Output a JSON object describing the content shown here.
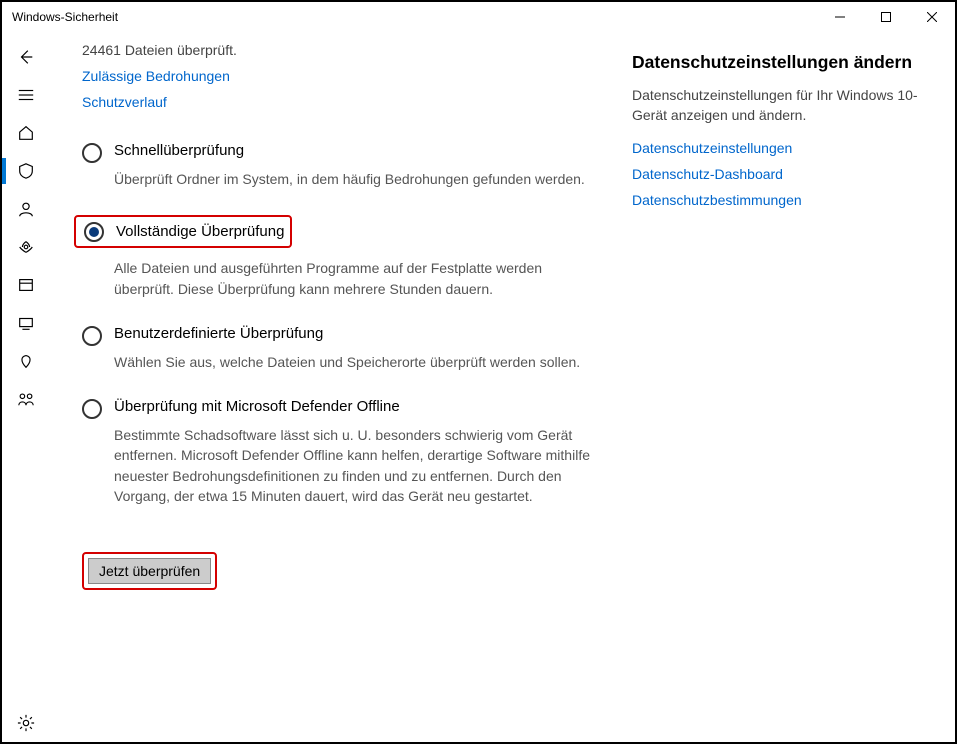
{
  "window": {
    "title": "Windows-Sicherheit"
  },
  "status": "24461 Dateien überprüft.",
  "links": {
    "allowed_threats": "Zulässige Bedrohungen",
    "protection_history": "Schutzverlauf"
  },
  "scan_options": [
    {
      "id": "quick",
      "title": "Schnellüberprüfung",
      "desc": "Überprüft Ordner im System, in dem häufig Bedrohungen gefunden werden.",
      "selected": false
    },
    {
      "id": "full",
      "title": "Vollständige Überprüfung",
      "desc": "Alle Dateien und ausgeführten Programme auf der Festplatte werden überprüft. Diese Überprüfung kann mehrere Stunden dauern.",
      "selected": true
    },
    {
      "id": "custom",
      "title": "Benutzerdefinierte Überprüfung",
      "desc": "Wählen Sie aus, welche Dateien und Speicherorte überprüft werden sollen.",
      "selected": false
    },
    {
      "id": "offline",
      "title": "Überprüfung mit Microsoft Defender Offline",
      "desc": "Bestimmte Schadsoftware lässt sich u. U. besonders schwierig vom Gerät entfernen. Microsoft Defender Offline kann helfen, derartige Software mithilfe neuester Bedrohungsdefinitionen zu finden und zu entfernen. Durch den Vorgang, der etwa 15 Minuten dauert, wird das Gerät neu gestartet.",
      "selected": false
    }
  ],
  "scan_button": "Jetzt überprüfen",
  "right": {
    "title": "Datenschutzeinstellungen ändern",
    "desc": "Datenschutzeinstellungen für Ihr Windows 10-Gerät anzeigen und ändern.",
    "links": [
      "Datenschutzeinstellungen",
      "Datenschutz-Dashboard",
      "Datenschutzbestimmungen"
    ]
  }
}
